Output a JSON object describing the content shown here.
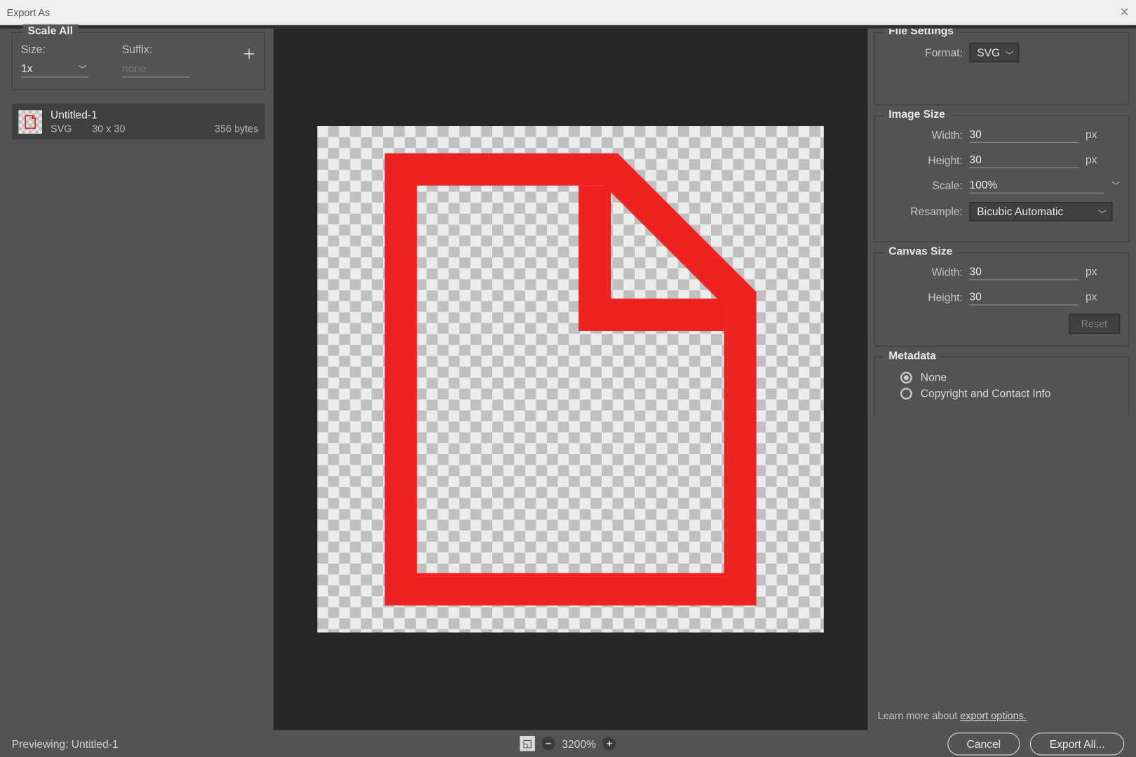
{
  "window": {
    "title": "Export As"
  },
  "scale_all": {
    "title": "Scale All",
    "size_label": "Size:",
    "suffix_label": "Suffix:",
    "size_value": "1x",
    "suffix_placeholder": "none"
  },
  "document": {
    "name": "Untitled-1",
    "format": "SVG",
    "dims": "30 x 30",
    "filesize": "356 bytes"
  },
  "file_settings": {
    "title": "File Settings",
    "format_label": "Format:",
    "format_value": "SVG"
  },
  "image_size": {
    "title": "Image Size",
    "width_label": "Width:",
    "width_value": "30",
    "height_label": "Height:",
    "height_value": "30",
    "scale_label": "Scale:",
    "scale_value": "100%",
    "resample_label": "Resample:",
    "resample_value": "Bicubic Automatic",
    "unit": "px"
  },
  "canvas_size": {
    "title": "Canvas Size",
    "width_label": "Width:",
    "width_value": "30",
    "height_label": "Height:",
    "height_value": "30",
    "unit": "px",
    "reset_label": "Reset"
  },
  "metadata": {
    "title": "Metadata",
    "option_none": "None",
    "option_copyright": "Copyright and Contact Info"
  },
  "learn_more": {
    "prefix": "Learn more about ",
    "link": "export options."
  },
  "footer": {
    "previewing_label": "Previewing:",
    "previewing_value": "Untitled-1",
    "zoom_value": "3200%",
    "cancel_label": "Cancel",
    "export_label": "Export All..."
  }
}
